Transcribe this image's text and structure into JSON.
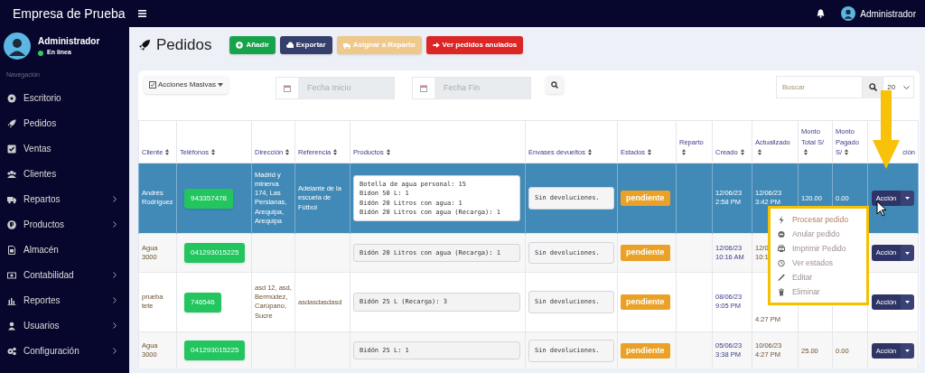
{
  "brand": "Empresa de Prueba",
  "user": {
    "name": "Administrador",
    "status": "En línea"
  },
  "topbar": {
    "user": "Administrador"
  },
  "sidebar": {
    "heading": "Navegación",
    "items": [
      {
        "label": "Escritorio",
        "has_submenu": false
      },
      {
        "label": "Pedidos",
        "has_submenu": false
      },
      {
        "label": "Ventas",
        "has_submenu": false
      },
      {
        "label": "Clientes",
        "has_submenu": false
      },
      {
        "label": "Repartos",
        "has_submenu": true
      },
      {
        "label": "Productos",
        "has_submenu": true
      },
      {
        "label": "Almacén",
        "has_submenu": false
      },
      {
        "label": "Contabilidad",
        "has_submenu": true
      },
      {
        "label": "Reportes",
        "has_submenu": true
      },
      {
        "label": "Usuarios",
        "has_submenu": true
      },
      {
        "label": "Configuración",
        "has_submenu": true
      }
    ]
  },
  "page_title": "Pedidos",
  "buttons": [
    {
      "label": "Añadir",
      "kind": "add"
    },
    {
      "label": "Exportar",
      "kind": "export"
    },
    {
      "label": "Asignar a Reparto",
      "kind": "assign"
    },
    {
      "label": "Ver pedidos anulados",
      "kind": "voided"
    }
  ],
  "toolbar": {
    "bulk": "Acciones Masivas",
    "date_start": {
      "placeholder": "Fecha Inicio"
    },
    "date_end": {
      "placeholder": "Fecha Fin"
    },
    "search": {
      "placeholder": "Buscar"
    },
    "page_size": "20"
  },
  "table": {
    "columns": [
      "Cliente",
      "Teléfonos",
      "Dirección",
      "Referencia",
      "Productos",
      "Envases devueltos",
      "Estados",
      "Reparto",
      "Creado",
      "Actualizado",
      "Monto Total S/",
      "Monto Pagado S/",
      "ción"
    ],
    "rows": [
      {
        "selected": true,
        "cliente": "Andrés Rodríguez",
        "telefono": "943357478",
        "direccion": "Madrid y minerva 174, Las Persianas, Arequipa, Arequipa",
        "referencia": "Adelante de la escuela de Fútbol",
        "productos": [
          "Botella de agua personal: 15",
          "Bidon 50 L: 1",
          "Bidón 20 Litros con agua: 1",
          "Bidón 20 Litros con agua (Recarga): 1"
        ],
        "envases": "Sin devoluciones.",
        "estado": "pendiente",
        "creado": [
          "12/06/23",
          "2:58 PM"
        ],
        "actualizado": [
          "12/06/23",
          "3:42 PM"
        ],
        "monto_total": "120.00",
        "monto_pagado": "0.00",
        "accion": "Acción"
      },
      {
        "selected": false,
        "cliente": "Agua 3000",
        "telefono": "041293015225",
        "productos": [
          "Bidón 20 Litros con agua (Recarga): 1"
        ],
        "envases": "Sin devoluciones.",
        "estado": "pendiente",
        "creado": [
          "12/06/23",
          "10:16 AM"
        ],
        "actualizado": [
          "12/0",
          "10:1"
        ],
        "accion": "Acción"
      },
      {
        "selected": false,
        "cliente": "prueba tete",
        "telefono": "746546",
        "direccion": "asd 12, asd, Bermúdez, Carúpano, Sucre",
        "referencia": "asdasdasdasd",
        "productos": [
          "Bidón 25 L (Recarga): 3"
        ],
        "envases": "Sin devoluciones.",
        "estado": "pendiente",
        "creado": [
          "08/06/23",
          "9:05 PM"
        ],
        "actualizado": [
          "4:27 PM"
        ],
        "accion": "Acción"
      },
      {
        "selected": false,
        "cliente": "Agua 3000",
        "telefono": "041293015225",
        "productos": [
          "Bidón 25 L: 1"
        ],
        "envases": "Sin devoluciones.",
        "estado": "pendiente",
        "creado": [
          "05/06/23",
          "3:38 PM"
        ],
        "actualizado": [
          "10/06/23",
          "4:27 PM"
        ],
        "monto_total": "25.00",
        "monto_pagado": "0.00",
        "accion": "Acción"
      }
    ]
  },
  "action_menu": {
    "items": [
      {
        "label": "Procesar pedido",
        "kind": "process"
      },
      {
        "label": "Anular pedido",
        "kind": "void"
      },
      {
        "label": "Imprimir Pedido",
        "kind": "print"
      },
      {
        "label": "Ver estados",
        "kind": "status"
      },
      {
        "label": "Editar",
        "kind": "edit"
      },
      {
        "label": "Eliminar",
        "kind": "delete"
      }
    ]
  }
}
